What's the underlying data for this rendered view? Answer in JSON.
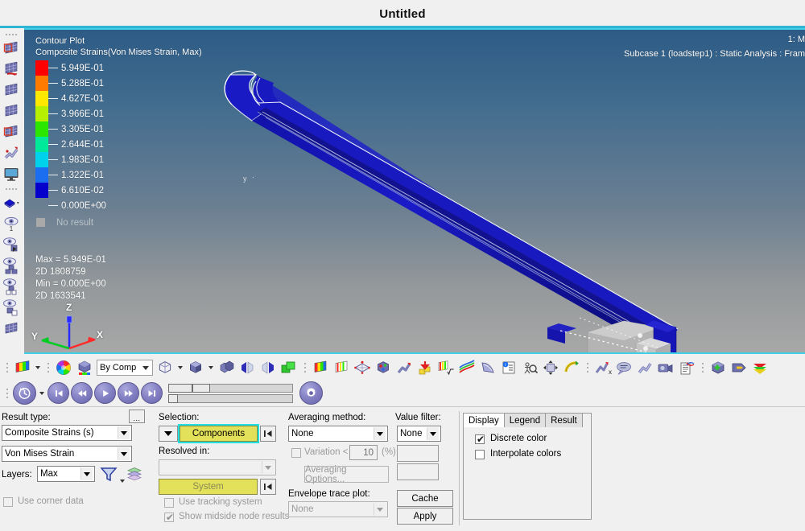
{
  "window": {
    "title": "Untitled"
  },
  "viewport": {
    "contour_title": "Contour Plot",
    "contour_subtitle": "Composite Strains(Von Mises Strain, Max)",
    "corner_line1": "1: M",
    "corner_line2": "Subcase 1 (loadstep1) : Static Analysis : Fram",
    "axis_x": "X",
    "axis_y": "Y",
    "axis_z": "Z",
    "legend": {
      "levels": [
        {
          "value": "5.949E-01",
          "color": "#ff0000"
        },
        {
          "value": "5.288E-01",
          "color": "#ff7b00"
        },
        {
          "value": "4.627E-01",
          "color": "#ffe800"
        },
        {
          "value": "3.966E-01",
          "color": "#b6f000"
        },
        {
          "value": "3.305E-01",
          "color": "#2ae600"
        },
        {
          "value": "2.644E-01",
          "color": "#00e89a"
        },
        {
          "value": "1.983E-01",
          "color": "#00d2ec"
        },
        {
          "value": "1.322E-01",
          "color": "#1c6ef0"
        },
        {
          "value": "6.610E-02",
          "color": "#0600cd"
        },
        {
          "value": "0.000E+00",
          "color": null
        }
      ],
      "no_result_label": "No result",
      "no_result_color": "#a9a9a9",
      "max_label": "Max = 5.949E-01",
      "max_entity": "2D 1808759",
      "min_label": "Min = 0.000E+00",
      "min_entity": "2D 1633541"
    }
  },
  "left_toolbar": {
    "items": [
      {
        "name": "contour-plot-icon"
      },
      {
        "name": "vector-plot-icon"
      },
      {
        "name": "iso-plot-icon"
      },
      {
        "name": "section-cut-icon"
      },
      {
        "name": "deformed-shape-icon"
      },
      {
        "name": "tensor-plot-icon"
      },
      {
        "name": "display-monitor-icon"
      },
      {
        "name": "entity-color-icon"
      },
      {
        "name": "visibility-page-icon"
      },
      {
        "name": "mask-icon"
      },
      {
        "name": "mask-group-icon"
      },
      {
        "name": "unmask-icon"
      },
      {
        "name": "isolate-icon"
      },
      {
        "name": "results-browser-icon"
      }
    ]
  },
  "toolbar_row1": {
    "by_comp_label": "By Comp",
    "icons": [
      "contour-icon",
      "color-wheel-icon",
      "cube-color-icon",
      "wireframe-cube-icon",
      "shaded-cube-icon",
      "exploded-cube-icon",
      "reflect-left-icon",
      "reflect-right-icon",
      "overlay-icon",
      "contour-gradient-icon",
      "bar-contour-icon",
      "iso-diamond-icon",
      "node-cube-icon",
      "deform-arrow-icon",
      "load-arrow-icon",
      "math-sqrt-contour-icon",
      "streamline-icon",
      "fringe-icon",
      "info-panel-icon",
      "query-magnifier-icon",
      "move-arrows-icon",
      "measure-arc-icon",
      "plot-x-icon",
      "note-bubble-icon",
      "deform-icon",
      "camera-icon",
      "report-icon",
      "add-part-icon",
      "shell-icon",
      "export-icon"
    ]
  },
  "toolbar_row2": {
    "icons": [
      "animate-icon",
      "first-frame-icon",
      "rewind-icon",
      "play-icon",
      "fast-forward-icon",
      "last-frame-icon",
      "animation-settings-icon"
    ]
  },
  "panel": {
    "result_type_label": "Result type:",
    "result_type_value": "Composite Strains (s)",
    "result_component_value": "Von Mises Strain",
    "ellipsis_label": "...",
    "layers_label": "Layers:",
    "layers_value": "Max",
    "use_corner_data_label": "Use corner data",
    "use_corner_data_checked": false,
    "selection_label": "Selection:",
    "components_button_label": "Components",
    "resolved_in_label": "Resolved in:",
    "resolved_in_value": "",
    "system_button_label": "System",
    "use_tracking_system_label": "Use tracking system",
    "use_tracking_system_checked": false,
    "show_midside_label": "Show midside node results",
    "show_midside_checked": true,
    "averaging_method_label": "Averaging method:",
    "averaging_method_value": "None",
    "variation_label": "Variation <",
    "variation_value": "10",
    "variation_unit": "(%)",
    "variation_checked": false,
    "averaging_options_label": "Averaging Options...",
    "envelope_trace_label": "Envelope trace plot:",
    "envelope_trace_value": "None",
    "value_filter_label": "Value filter:",
    "value_filter_value": "None",
    "value_filter_min": "",
    "value_filter_max": "",
    "cache_button_label": "Cache",
    "apply_button_label": "Apply",
    "tabs": [
      {
        "label": "Display",
        "active": true
      },
      {
        "label": "Legend",
        "active": false
      },
      {
        "label": "Result",
        "active": false
      }
    ],
    "discrete_color_label": "Discrete color",
    "discrete_color_checked": true,
    "interpolate_colors_label": "Interpolate colors",
    "interpolate_colors_checked": false
  },
  "colors": {
    "accent_cyan": "#3fd0e8",
    "yellow_button": "#e3e05a",
    "panel_bg": "#f0f0f0",
    "model_blue": "#1414b4"
  }
}
